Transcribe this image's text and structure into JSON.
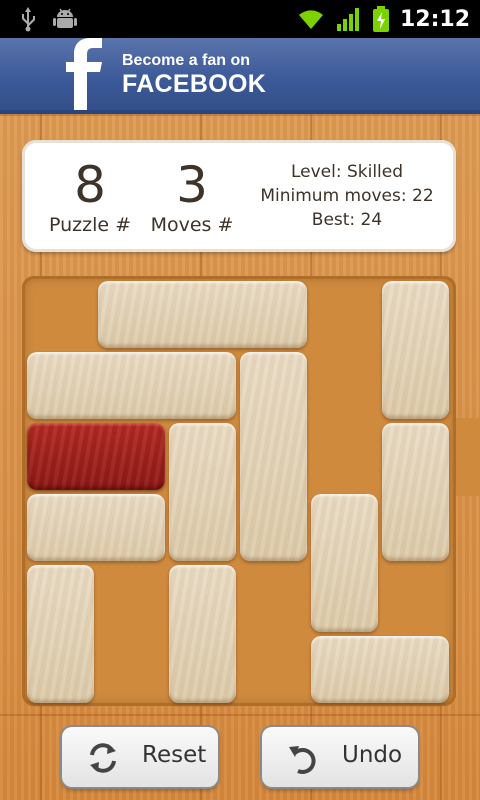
{
  "status_bar": {
    "time": "12:12",
    "icons": [
      "usb-icon",
      "android-debug-icon",
      "wifi-icon",
      "signal-icon",
      "battery-charging-icon"
    ]
  },
  "facebook_banner": {
    "line1": "Become a fan on",
    "line2": "FACEBOOK",
    "color": "#3b5998"
  },
  "stats": {
    "puzzle_number": "8",
    "puzzle_label": "Puzzle #",
    "moves_number": "3",
    "moves_label": "Moves #",
    "level": "Level: Skilled",
    "minimum_moves": "Minimum moves: 22",
    "best": "Best: 24"
  },
  "board": {
    "grid_size": 6,
    "blocks": [
      {
        "col": 1,
        "row": 0,
        "w": 3,
        "h": 1,
        "red": false
      },
      {
        "col": 5,
        "row": 0,
        "w": 1,
        "h": 2,
        "red": false
      },
      {
        "col": 0,
        "row": 1,
        "w": 3,
        "h": 1,
        "red": false
      },
      {
        "col": 3,
        "row": 1,
        "w": 1,
        "h": 3,
        "red": false
      },
      {
        "col": 0,
        "row": 2,
        "w": 2,
        "h": 1,
        "red": true
      },
      {
        "col": 2,
        "row": 2,
        "w": 1,
        "h": 2,
        "red": false
      },
      {
        "col": 5,
        "row": 2,
        "w": 1,
        "h": 2,
        "red": false
      },
      {
        "col": 0,
        "row": 3,
        "w": 2,
        "h": 1,
        "red": false
      },
      {
        "col": 4,
        "row": 3,
        "w": 1,
        "h": 2,
        "red": false
      },
      {
        "col": 0,
        "row": 4,
        "w": 1,
        "h": 2,
        "red": false
      },
      {
        "col": 2,
        "row": 4,
        "w": 1,
        "h": 2,
        "red": false
      },
      {
        "col": 4,
        "row": 5,
        "w": 2,
        "h": 1,
        "red": false
      }
    ]
  },
  "buttons": {
    "reset_label": "Reset",
    "undo_label": "Undo"
  }
}
